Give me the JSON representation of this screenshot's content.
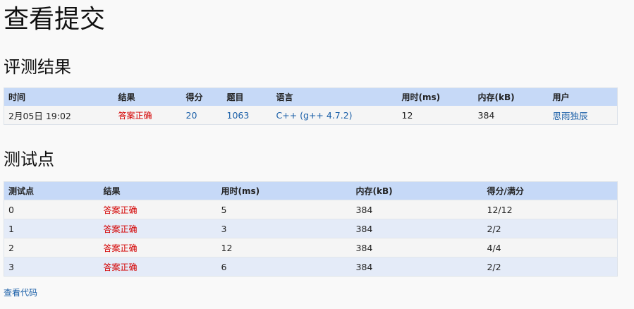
{
  "page": {
    "title": "查看提交"
  },
  "result_section": {
    "heading": "评测结果",
    "columns": [
      "时间",
      "结果",
      "得分",
      "题目",
      "语言",
      "用时(ms)",
      "内存(kB)",
      "用户"
    ],
    "row": {
      "time": "2月05日 19:02",
      "result": "答案正确",
      "score": "20",
      "problem": "1063",
      "language": "C++ (g++ 4.7.2)",
      "time_ms": "12",
      "memory_kb": "384",
      "user": "思雨独辰"
    }
  },
  "tests_section": {
    "heading": "测试点",
    "columns": [
      "测试点",
      "结果",
      "用时(ms)",
      "内存(kB)",
      "得分/满分"
    ],
    "rows": [
      {
        "id": "0",
        "result": "答案正确",
        "time_ms": "5",
        "memory_kb": "384",
        "score": "12/12"
      },
      {
        "id": "1",
        "result": "答案正确",
        "time_ms": "3",
        "memory_kb": "384",
        "score": "2/2"
      },
      {
        "id": "2",
        "result": "答案正确",
        "time_ms": "12",
        "memory_kb": "384",
        "score": "4/4"
      },
      {
        "id": "3",
        "result": "答案正确",
        "time_ms": "6",
        "memory_kb": "384",
        "score": "2/2"
      }
    ]
  },
  "footer": {
    "view_code_label": "查看代码"
  },
  "colors": {
    "header_bg": "#c6d9f7",
    "status_ok": "#d40000",
    "link": "#1a5fa8",
    "row_alt": "#e4ebf8"
  }
}
